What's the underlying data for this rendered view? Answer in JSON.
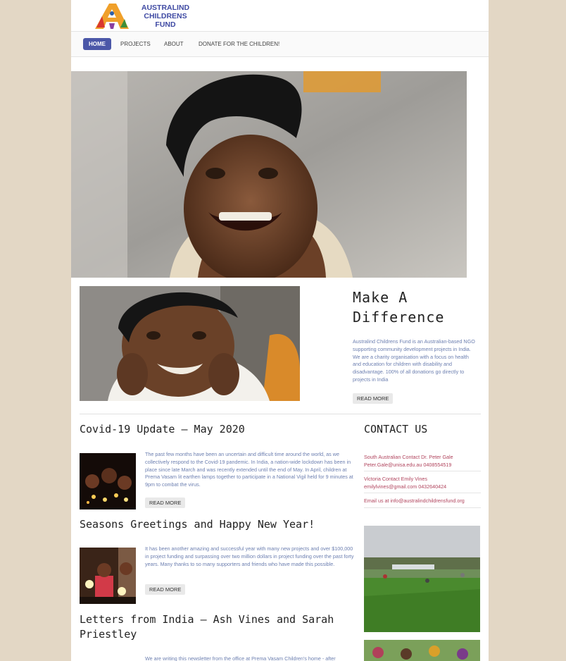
{
  "logo": {
    "line1": "AUSTRALIND",
    "line2": "CHILDRENS",
    "line3": "FUND"
  },
  "nav": {
    "items": [
      "HOME",
      "PROJECTS",
      "ABOUT",
      "DONATE FOR THE CHILDREN!"
    ],
    "active": "HOME"
  },
  "intro": {
    "title_line1": "Make A",
    "title_line2": "Difference",
    "text": "Australind Childrens Fund is an Australian-based NGO supporting community development projects in India. We are a charity organisation with a focus on health and education for children with disability and disadvantage. 100% of all donations go directly to projects in India",
    "button": "READ MORE"
  },
  "posts": [
    {
      "title": "Covid-19 Update – May 2020",
      "text": "The past few months have been an uncertain and difficult time around the world, as we collectively respond to the Covid-19 pandemic. In India, a nation-wide lockdown has been in place since late March and was recently extended until the end of May. In April, children at Prema Vasam lit earthen lamps together to participate in a National Vigil held for 9 minutes at 9pm to combat the virus.",
      "button": "READ MORE"
    },
    {
      "title": "Seasons Greetings and Happy New Year!",
      "text": "It has been another amazing and successful year with many new projects and over $100,000 in project funding and surpassing over two million dollars in project funding over the past forty years. Many thanks to so many supporters and friends who have made this possible.",
      "button": "READ MORE"
    },
    {
      "title": "Letters from India – Ash Vines and Sarah Priestley",
      "text": "We are writing this newsletter from the office at Prema Vasam Children's home - after"
    }
  ],
  "contact": {
    "title": "CONTACT US",
    "sa_line1": "South Australian Contact Dr. Peter Gale",
    "sa_line2": "Peter.Gale@unisa.edu.au 0408554519",
    "vic_line1": "Victoria Contact Emily Vines",
    "vic_line2": "emilylvines@gmail.com 0432640424",
    "email_line": "Email us at info@australindchildrensfund.org"
  },
  "colors": {
    "accent": "#4b57a8",
    "link": "#b1455e",
    "body_text": "#6c7fb0",
    "background": "#e3d7c5"
  }
}
